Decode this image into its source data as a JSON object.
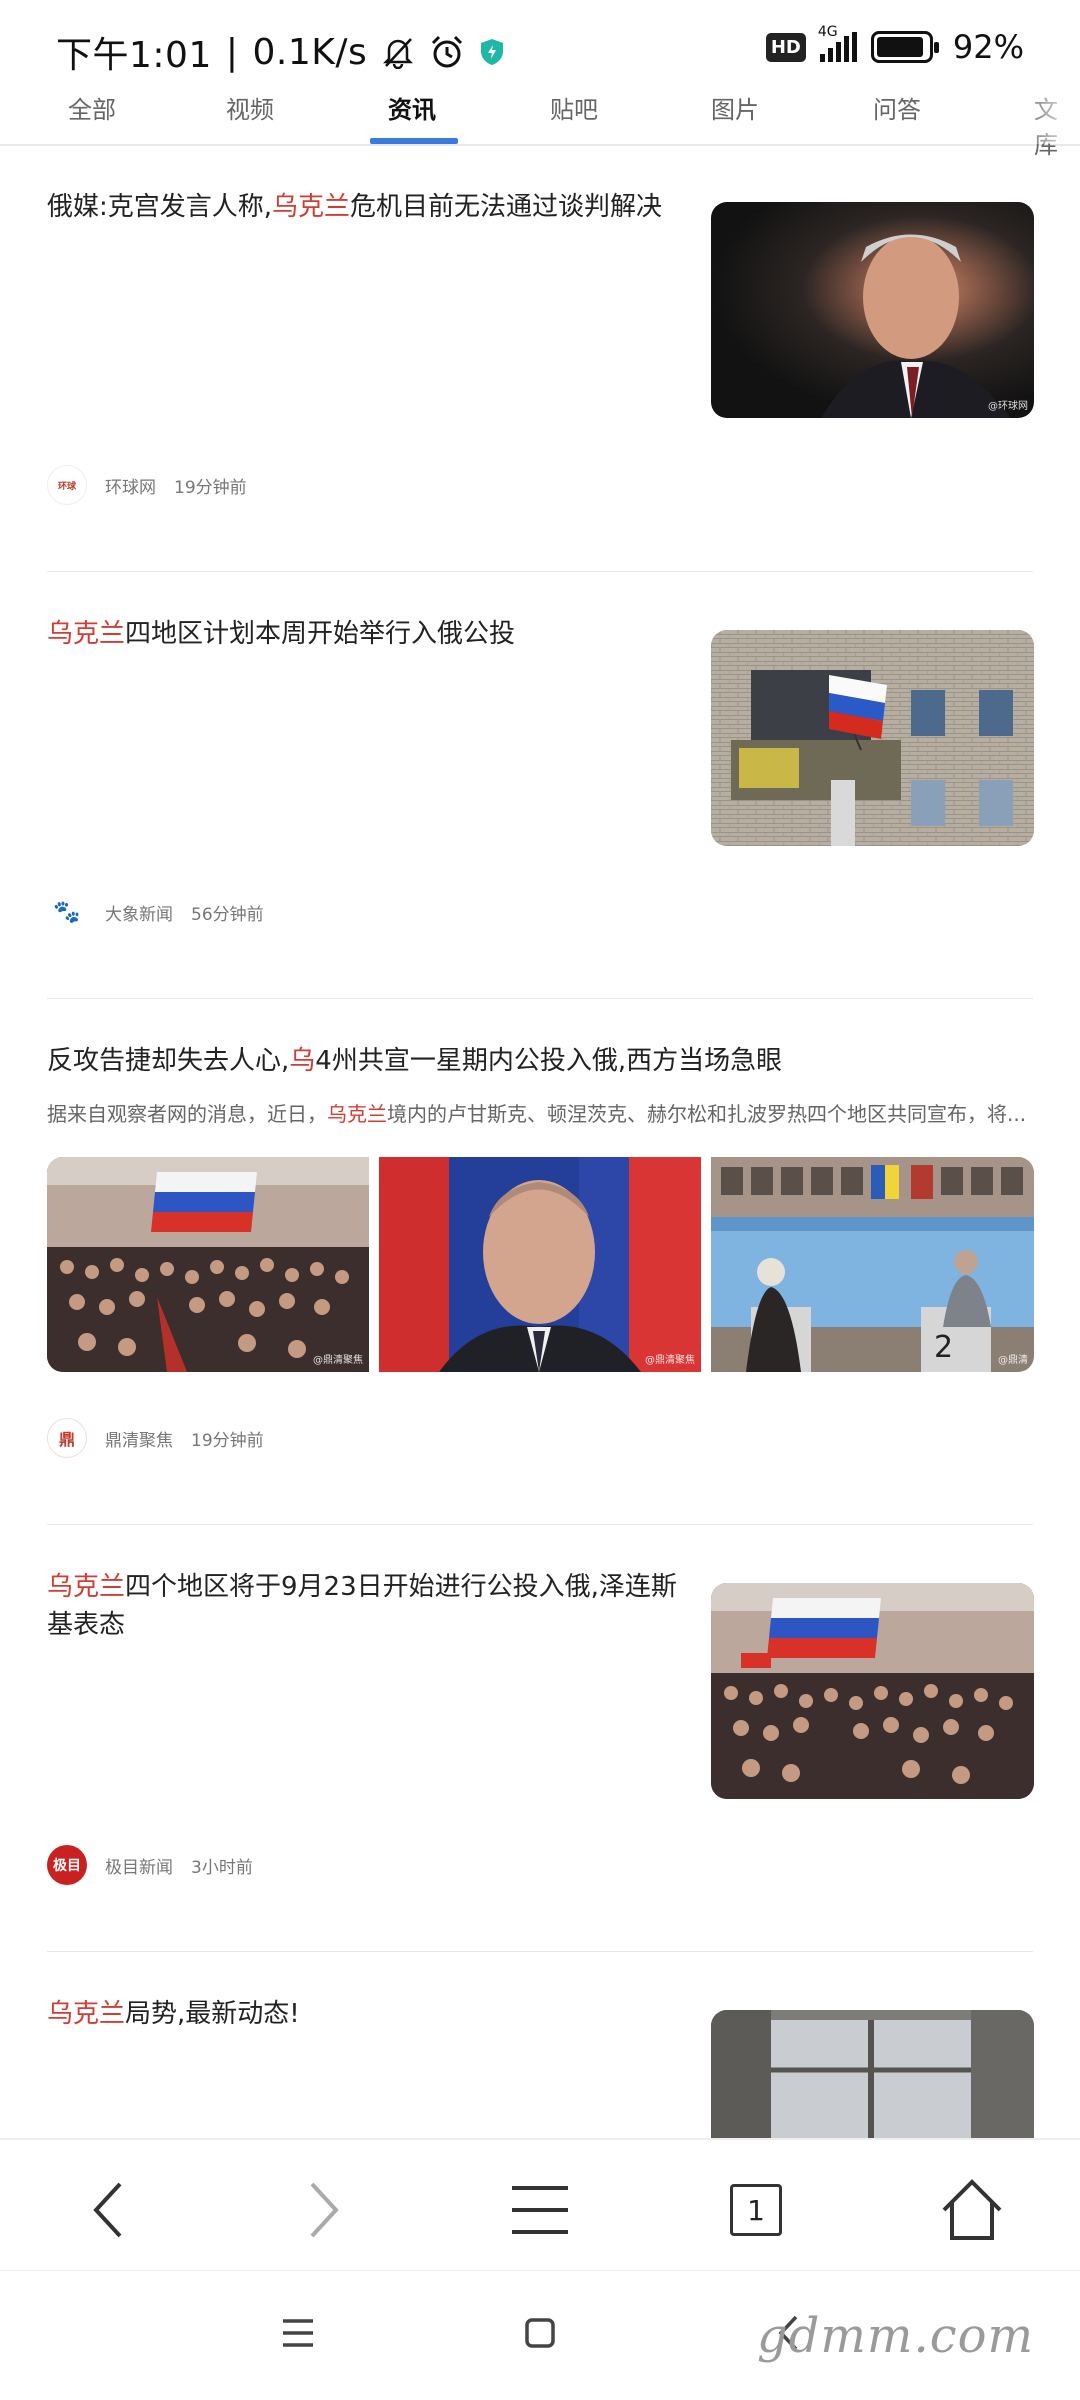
{
  "status_bar": {
    "time": "下午1:01",
    "speed": "0.1K/s",
    "hd": "HD",
    "network": "4G",
    "battery": "92%",
    "icons": [
      "bell-off-icon",
      "alarm-icon",
      "shield-vpn-icon",
      "hd-icon",
      "signal-icon",
      "battery-icon"
    ]
  },
  "tabs": {
    "items": [
      "全部",
      "视频",
      "资讯",
      "贴吧",
      "图片",
      "问答",
      "文库"
    ],
    "active": "资讯"
  },
  "articles": [
    {
      "title_hl": "",
      "title_pre": "俄媒:克宫发言人称,",
      "title_hl2": "乌克兰",
      "title_post": "危机目前无法通过谈判解决",
      "source": "环球网",
      "time": "19分钟前",
      "image_watermark": "@环球网"
    },
    {
      "title_hl": "乌克兰",
      "title_post": "四地区计划本周开始举行入俄公投",
      "source": "大象新闻",
      "time": "56分钟前"
    },
    {
      "title_pre": "反攻告捷却失去人心,",
      "title_hl2": "乌",
      "title_post": "4州共宣一星期内公投入俄,西方当场急眼",
      "snippet_pre": "据来自观察者网的消息，近日，",
      "snippet_hl": "乌克兰",
      "snippet_post": "境内的卢甘斯克、顿涅茨克、赫尔松和扎波罗热四个地区共同宣布，将...",
      "source": "鼎清聚焦",
      "time": "19分钟前",
      "image_watermarks": [
        "@鼎清聚焦",
        "@鼎清聚焦",
        "@鼎清"
      ]
    },
    {
      "title_hl": "乌克兰",
      "title_post": "四个地区将于9月23日开始进行公投入俄,泽连斯基表态",
      "source": "极目新闻",
      "time": "3小时前"
    },
    {
      "title_hl": "乌克兰",
      "title_post": "局势,最新动态!"
    }
  ],
  "toolbar": {
    "tab_count": "1",
    "icons": [
      "back-icon",
      "forward-icon",
      "menu-icon",
      "tabs-icon",
      "home-icon"
    ]
  },
  "watermark": "gdmm.com"
}
